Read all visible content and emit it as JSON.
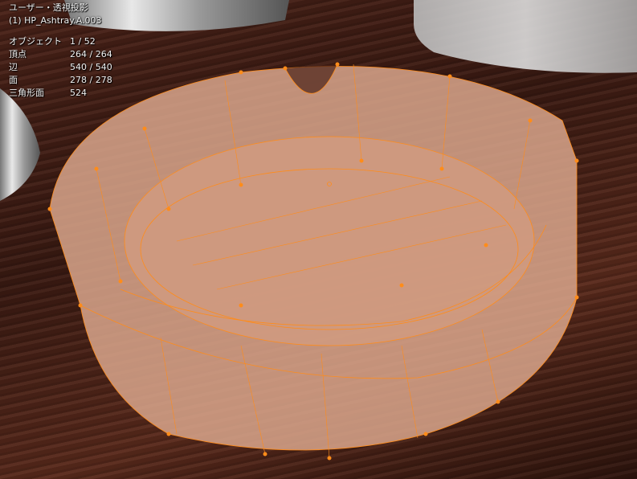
{
  "viewport": {
    "view_name": "ユーザー・透視投影",
    "object_name": "(1) HP_Ashtray.A.003"
  },
  "stats": [
    {
      "label": "オブジェクト",
      "value": "1 / 52"
    },
    {
      "label": "頂点",
      "value": "264 / 264"
    },
    {
      "label": "辺",
      "value": "540 / 540"
    },
    {
      "label": "面",
      "value": "278 / 278"
    },
    {
      "label": "三角形面",
      "value": "524"
    }
  ],
  "colors": {
    "wire": "#ff8c1a",
    "mesh": "#d9a68c"
  }
}
